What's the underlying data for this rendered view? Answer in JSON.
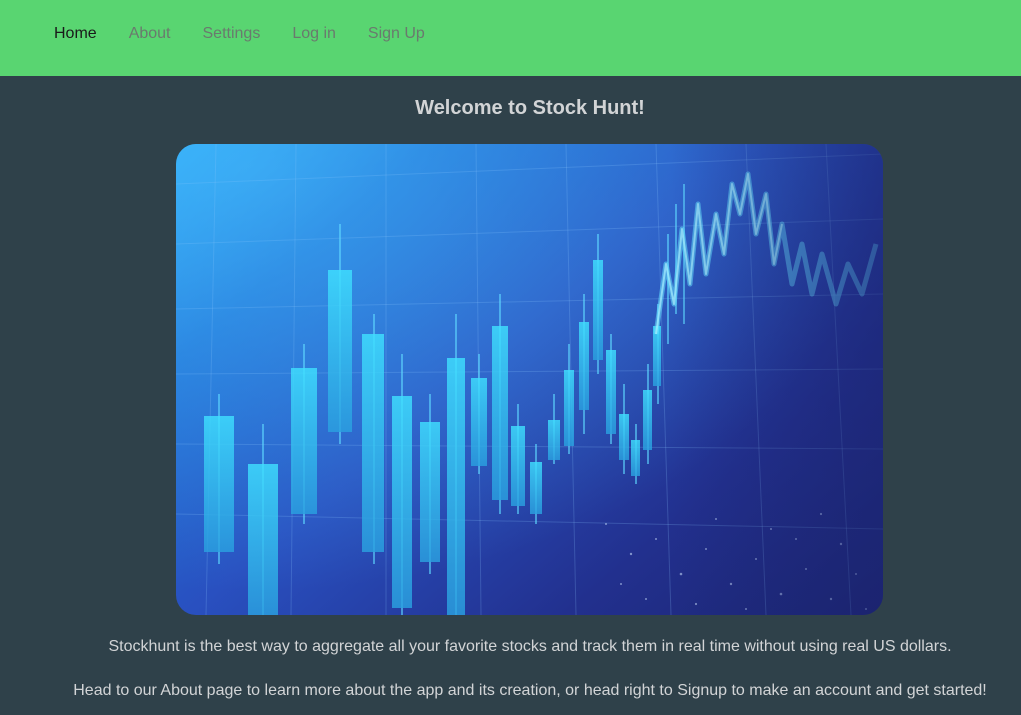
{
  "nav": {
    "items": [
      {
        "label": "Home",
        "active": true
      },
      {
        "label": "About",
        "active": false
      },
      {
        "label": "Settings",
        "active": false
      },
      {
        "label": "Log in",
        "active": false
      },
      {
        "label": "Sign Up",
        "active": false
      }
    ]
  },
  "main": {
    "title": "Welcome to Stock Hunt!",
    "hero_image": "stock-candlestick-chart-image",
    "paragraph_1": "Stockhunt is the best way to aggregate all your favorite stocks and track them in real time without using real US dollars.",
    "paragraph_2": "Head to our About page to learn more about the app and its creation, or head right to Signup to make an account and get started!"
  },
  "colors": {
    "navbar_bg": "#59d571",
    "page_bg": "#2f414a",
    "text": "#d2d4d6",
    "nav_active": "#1a1a1a",
    "nav_inactive": "#6a7a6e"
  }
}
